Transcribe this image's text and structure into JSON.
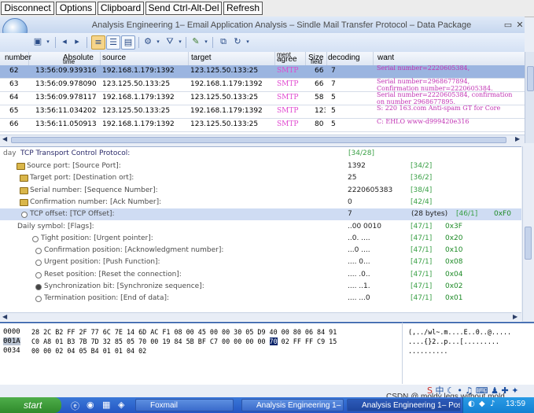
{
  "vnc": {
    "disconnect": "Disconnect",
    "options": "Options",
    "clipboard": "Clipboard",
    "ctrl_alt_del": "Send Ctrl-Alt-Del",
    "refresh": "Refresh"
  },
  "window": {
    "title": "Analysis Engineering 1– Email Application Analysis – Sindle Mail Transfer Protocol – Data Package"
  },
  "packets": {
    "headers": {
      "number": "number",
      "time": "Absolute",
      "time_sub": "time",
      "source": "source",
      "target": "target",
      "protocol": "agree",
      "protocol_sub": "ment",
      "size": "Size",
      "size_sub": "field",
      "decoding": "decoding",
      "want": "want"
    },
    "rows": [
      {
        "number": "62",
        "time": "13:56:09.939316",
        "source": "192.168.1.179:1392",
        "target": "123.125.50.133:25",
        "protocol": "SMTP",
        "size": "66",
        "decoding": "7",
        "want": "Serial number=2220605384,",
        "want2": "",
        "selected": true
      },
      {
        "number": "63",
        "time": "13:56:09.978090",
        "source": "123.125.50.133:25",
        "target": "192.168.1.179:1392",
        "protocol": "SMTP",
        "size": "66",
        "decoding": "7",
        "want": "Serial number=2968677894,",
        "want2": "Confirmation number=2220605384.",
        "selected": false
      },
      {
        "number": "64",
        "time": "13:56:09.978117",
        "source": "192.168.1.179:1392",
        "target": "123.125.50.133:25",
        "protocol": "SMTP",
        "size": "58",
        "decoding": "5",
        "want": "Serial number=2220605384, confirmation",
        "want2": "on number 2968677895.",
        "selected": false
      },
      {
        "number": "65",
        "time": "13:56:11.034202",
        "source": "123.125.50.133:25",
        "target": "192.168.1.179:1392",
        "protocol": "SMTP",
        "size": "123",
        "decoding": "5",
        "want": "S: 220 163.com Anti-spam GT for Core",
        "want2": "",
        "selected": false
      },
      {
        "number": "66",
        "time": "13:56:11.050913",
        "source": "192.168.1.179:1392",
        "target": "123.125.50.133:25",
        "protocol": "SMTP",
        "size": "80",
        "decoding": "5",
        "want": "C: EHLO www-d999420e316",
        "want2": "",
        "selected": false
      }
    ]
  },
  "details": {
    "section_prefix": "day",
    "section_title": "TCP Transport Control Protocol:",
    "section_range": "[34/28]",
    "rows": [
      {
        "label": "Source port: [Source Port]:",
        "value": "1392",
        "range": "[34/2]",
        "hex": "",
        "icon": "lock",
        "indent": 34
      },
      {
        "label": "Target port: [Destination ort]:",
        "value": "25",
        "range": "[36/2]",
        "hex": "",
        "icon": "lock",
        "indent": 38
      },
      {
        "label": "Serial number: [Sequence Number]:",
        "value": "2220605383",
        "range": "[38/4]",
        "hex": "",
        "icon": "lock",
        "indent": 38
      },
      {
        "label": "Confirmation number: [Ack Number]:",
        "value": "0",
        "range": "[42/4]",
        "hex": "",
        "icon": "lock",
        "indent": 38
      },
      {
        "label": "TCP offset: [TCP Offset]:",
        "value": "7",
        "value2": "(28 bytes)",
        "range": "[46/1]",
        "hex": "0xF0",
        "icon": "bullet",
        "indent": 38,
        "selected": true
      },
      {
        "label": "Daily symbol: [Flags]:",
        "value": "..00 0010",
        "range": "[47/1]",
        "hex": "0x3F",
        "icon": "none",
        "indent": 22
      },
      {
        "label": "Tight position: [Urgent pointer]:",
        "value": "..0. ....",
        "range": "[47/1]",
        "hex": "0x20",
        "icon": "bullet",
        "indent": 52
      },
      {
        "label": "Confirmation position: [Acknowledgment number]:",
        "value": "...0 ....",
        "range": "[47/1]",
        "hex": "0x10",
        "icon": "bullet",
        "indent": 56
      },
      {
        "label": "Urgent position: [Push Function]:",
        "value": ".... 0...",
        "range": "[47/1]",
        "hex": "0x08",
        "icon": "bullet",
        "indent": 56
      },
      {
        "label": "Reset position: [Reset the connection]:",
        "value": ".... .0..",
        "range": "[47/1]",
        "hex": "0x04",
        "icon": "bullet",
        "indent": 56
      },
      {
        "label": "Synchronization bit: [Synchronize sequence]:",
        "value": ".... ..1.",
        "range": "[47/1]",
        "hex": "0x02",
        "icon": "dark",
        "indent": 56
      },
      {
        "label": "Termination position: [End of data]:",
        "value": ".... ...0",
        "range": "[47/1]",
        "hex": "0x01",
        "icon": "bullet",
        "indent": 56
      }
    ]
  },
  "hexdump": {
    "rows": [
      {
        "offset": "0000",
        "bytes_pre": "28 2C B2 FF 2F 77 6C 7E 14 6D AC F1 08 00 45 00 00 30 05 D9 40 00 80 06 84 91",
        "bytes_hl": "",
        "bytes_post": "",
        "ascii": "(,../wl~.m....E..0..@.....",
        "selected": false
      },
      {
        "offset": "001A",
        "bytes_pre": "C0 A8 01 B3 7B 7D 32 85 05 70 00 19 84 5B BF C7 00 00 00 00 ",
        "bytes_hl": "70",
        "bytes_post": " 02 FF FF C9 15",
        "ascii": "....{}2..p...[.........",
        "selected": true
      },
      {
        "offset": "0034",
        "bytes_pre": "00 00 02 04 05 B4 01 01 04 02",
        "bytes_hl": "",
        "bytes_post": "",
        "ascii": "..........",
        "selected": false
      }
    ]
  },
  "taskbar": {
    "start": "start",
    "tasks": [
      "Foxmail",
      "Analysis Engineering 1–",
      "Analysis Engineering 1– Posta"
    ],
    "clock": "13:59",
    "watermark": "CSDN @ moldy legs without mold"
  },
  "colors": {
    "selected_row": "#9bb5e0",
    "protocol": "#e048d0",
    "hex_green": "#1d8a26",
    "accent": "#4a72b4"
  }
}
